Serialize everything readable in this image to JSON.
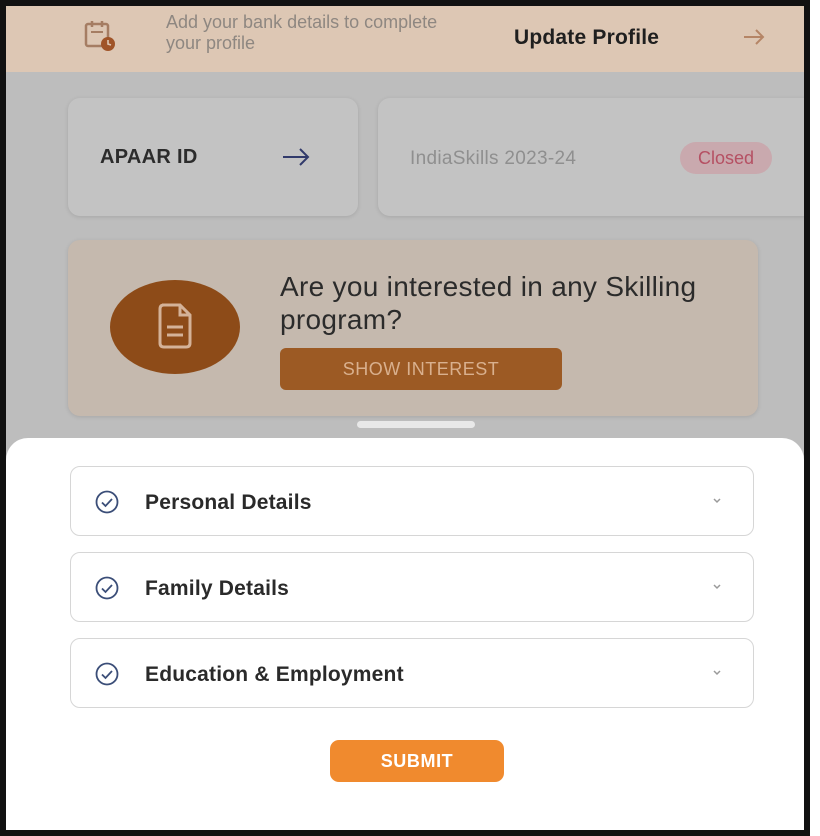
{
  "banner": {
    "message": "Add your bank details to complete your profile",
    "action_label": "Update Profile",
    "icon": "calendar-clock-icon",
    "arrow_icon": "arrow-right-icon"
  },
  "apaar_card": {
    "label": "APAAR ID",
    "arrow_icon": "arrow-right-icon"
  },
  "skills_card": {
    "label": "IndiaSkills 2023-24",
    "status": "Closed"
  },
  "skilling_card": {
    "question": "Are you interested in any Skilling program?",
    "button_label": "SHOW INTEREST",
    "icon": "document-icon"
  },
  "sheet": {
    "sections": [
      {
        "label": "Personal Details",
        "status_icon": "check-circle-icon",
        "expand_icon": "chevron-down-icon"
      },
      {
        "label": "Family Details",
        "status_icon": "check-circle-icon",
        "expand_icon": "chevron-down-icon"
      },
      {
        "label": "Education & Employment",
        "status_icon": "check-circle-icon",
        "expand_icon": "chevron-down-icon"
      }
    ],
    "submit_label": "SUBMIT"
  },
  "colors": {
    "accent": "#f08a2e",
    "check_icon": "#3b4e78",
    "closed_badge_text": "#b55063"
  }
}
